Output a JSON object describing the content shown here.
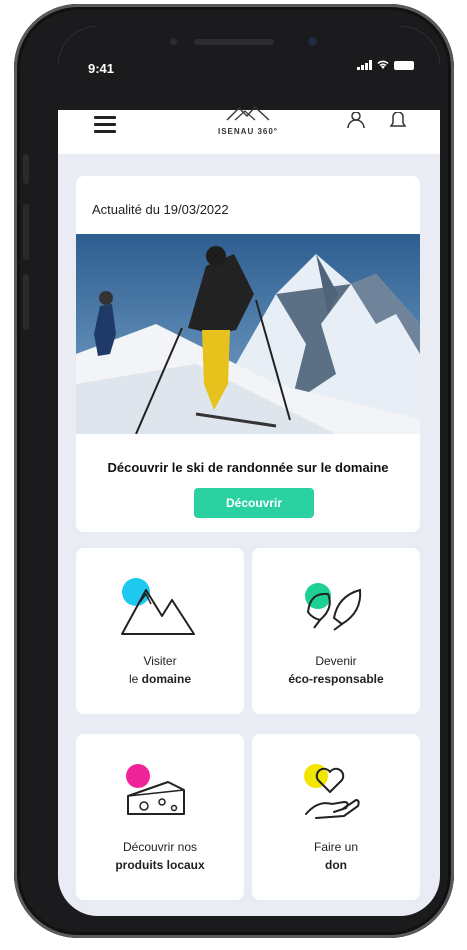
{
  "status": {
    "time": "9:41"
  },
  "header": {
    "logo_text": "ISENAU 360°"
  },
  "news": {
    "date_label": "Actualité du 19/03/2022",
    "title": "Découvrir le ski de randonnée sur le domaine",
    "button_label": "Découvrir"
  },
  "tiles": [
    {
      "line1": "Visiter",
      "line2_prefix": "le ",
      "line2_bold": "domaine",
      "icon": "mountain-icon",
      "accent": "#1ec9f0"
    },
    {
      "line1": "Devenir",
      "line2_prefix": "",
      "line2_bold": "éco-responsable",
      "icon": "leaf-icon",
      "accent": "#1ecf96"
    },
    {
      "line1": "Découvrir nos",
      "line2_prefix": "",
      "line2_bold": "produits locaux",
      "icon": "cheese-icon",
      "accent": "#f0239a"
    },
    {
      "line1": "Faire un",
      "line2_prefix": "",
      "line2_bold": "don",
      "icon": "heart-hand-icon",
      "accent": "#f2e600"
    }
  ],
  "colors": {
    "accent_button": "#2bd1a1",
    "screen_bg": "#e9edf3"
  }
}
